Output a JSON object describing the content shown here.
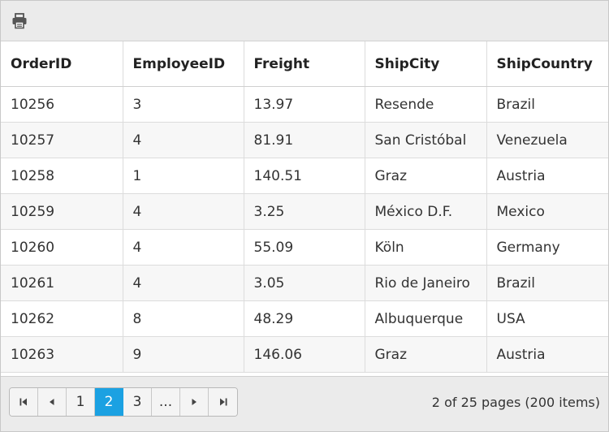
{
  "toolbar": {
    "print_icon": "printer-icon"
  },
  "grid": {
    "columns": [
      "OrderID",
      "EmployeeID",
      "Freight",
      "ShipCity",
      "ShipCountry"
    ],
    "rows": [
      [
        "10256",
        "3",
        "13.97",
        "Resende",
        "Brazil"
      ],
      [
        "10257",
        "4",
        "81.91",
        "San Cristóbal",
        "Venezuela"
      ],
      [
        "10258",
        "1",
        "140.51",
        "Graz",
        "Austria"
      ],
      [
        "10259",
        "4",
        "3.25",
        "México D.F.",
        "Mexico"
      ],
      [
        "10260",
        "4",
        "55.09",
        "Köln",
        "Germany"
      ],
      [
        "10261",
        "4",
        "3.05",
        "Rio de Janeiro",
        "Brazil"
      ],
      [
        "10262",
        "8",
        "48.29",
        "Albuquerque",
        "USA"
      ],
      [
        "10263",
        "9",
        "146.06",
        "Graz",
        "Austria"
      ]
    ]
  },
  "pager": {
    "first_icon": "first-page-icon",
    "prev_icon": "previous-page-icon",
    "pages": [
      "1",
      "2",
      "3"
    ],
    "current_page": "2",
    "ellipsis": "...",
    "next_icon": "next-page-icon",
    "last_icon": "last-page-icon",
    "info": "2 of 25 pages (200 items)"
  },
  "colors": {
    "accent": "#1ba1e2",
    "toolbar_bg": "#ebebeb",
    "alt_row": "#f7f7f7"
  }
}
